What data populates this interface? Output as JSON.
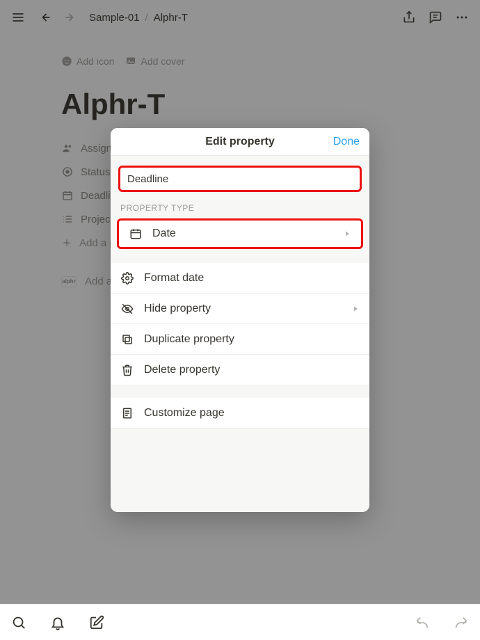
{
  "breadcrumb": {
    "parent": "Sample-01",
    "current": "Alphr-T"
  },
  "page": {
    "add_icon": "Add icon",
    "add_cover": "Add cover",
    "title": "Alphr-T",
    "props": {
      "assign": "Assign",
      "status": "Status",
      "deadline": "Deadline",
      "projects": "Projects",
      "add_property": "Add a p",
      "add_comment": "Add a c"
    },
    "avatar_text": "alphr"
  },
  "sheet": {
    "title": "Edit property",
    "done": "Done",
    "name_value": "Deadline",
    "section_type": "PROPERTY TYPE",
    "type_label": "Date",
    "format_date": "Format date",
    "hide": "Hide property",
    "duplicate": "Duplicate property",
    "delete": "Delete property",
    "customize": "Customize page"
  }
}
